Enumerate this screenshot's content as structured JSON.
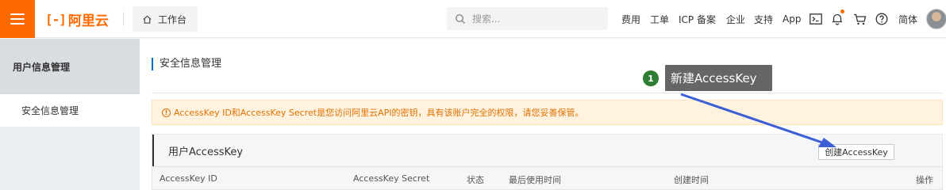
{
  "topbar": {
    "logo_mark": "[-]",
    "logo_text": "阿里云",
    "workbench_label": "工作台",
    "search_placeholder": "搜索...",
    "nav": {
      "fees": "费用",
      "tickets": "工单",
      "icp": "ICP 备案",
      "enterprise": "企业",
      "support": "支持",
      "app": "App",
      "language": "简体"
    },
    "accent_color": "#ff6a00"
  },
  "sidebar": {
    "title": "用户信息管理",
    "items": [
      {
        "label": "安全信息管理"
      }
    ]
  },
  "main": {
    "page_title": "安全信息管理",
    "warning": "AccessKey ID和AccessKey Secret是您访问阿里云API的密钥，具有该账户完全的权限，请您妥善保管。",
    "panel_title": "用户AccessKey",
    "create_button": "创建AccessKey",
    "table_headers": [
      "AccessKey ID",
      "AccessKey Secret",
      "状态",
      "最后使用时间",
      "创建时间",
      "操作"
    ]
  },
  "annotation": {
    "step_number": "1",
    "tooltip": "新建AccessKey",
    "arrow_color": "#3c5fd6"
  }
}
